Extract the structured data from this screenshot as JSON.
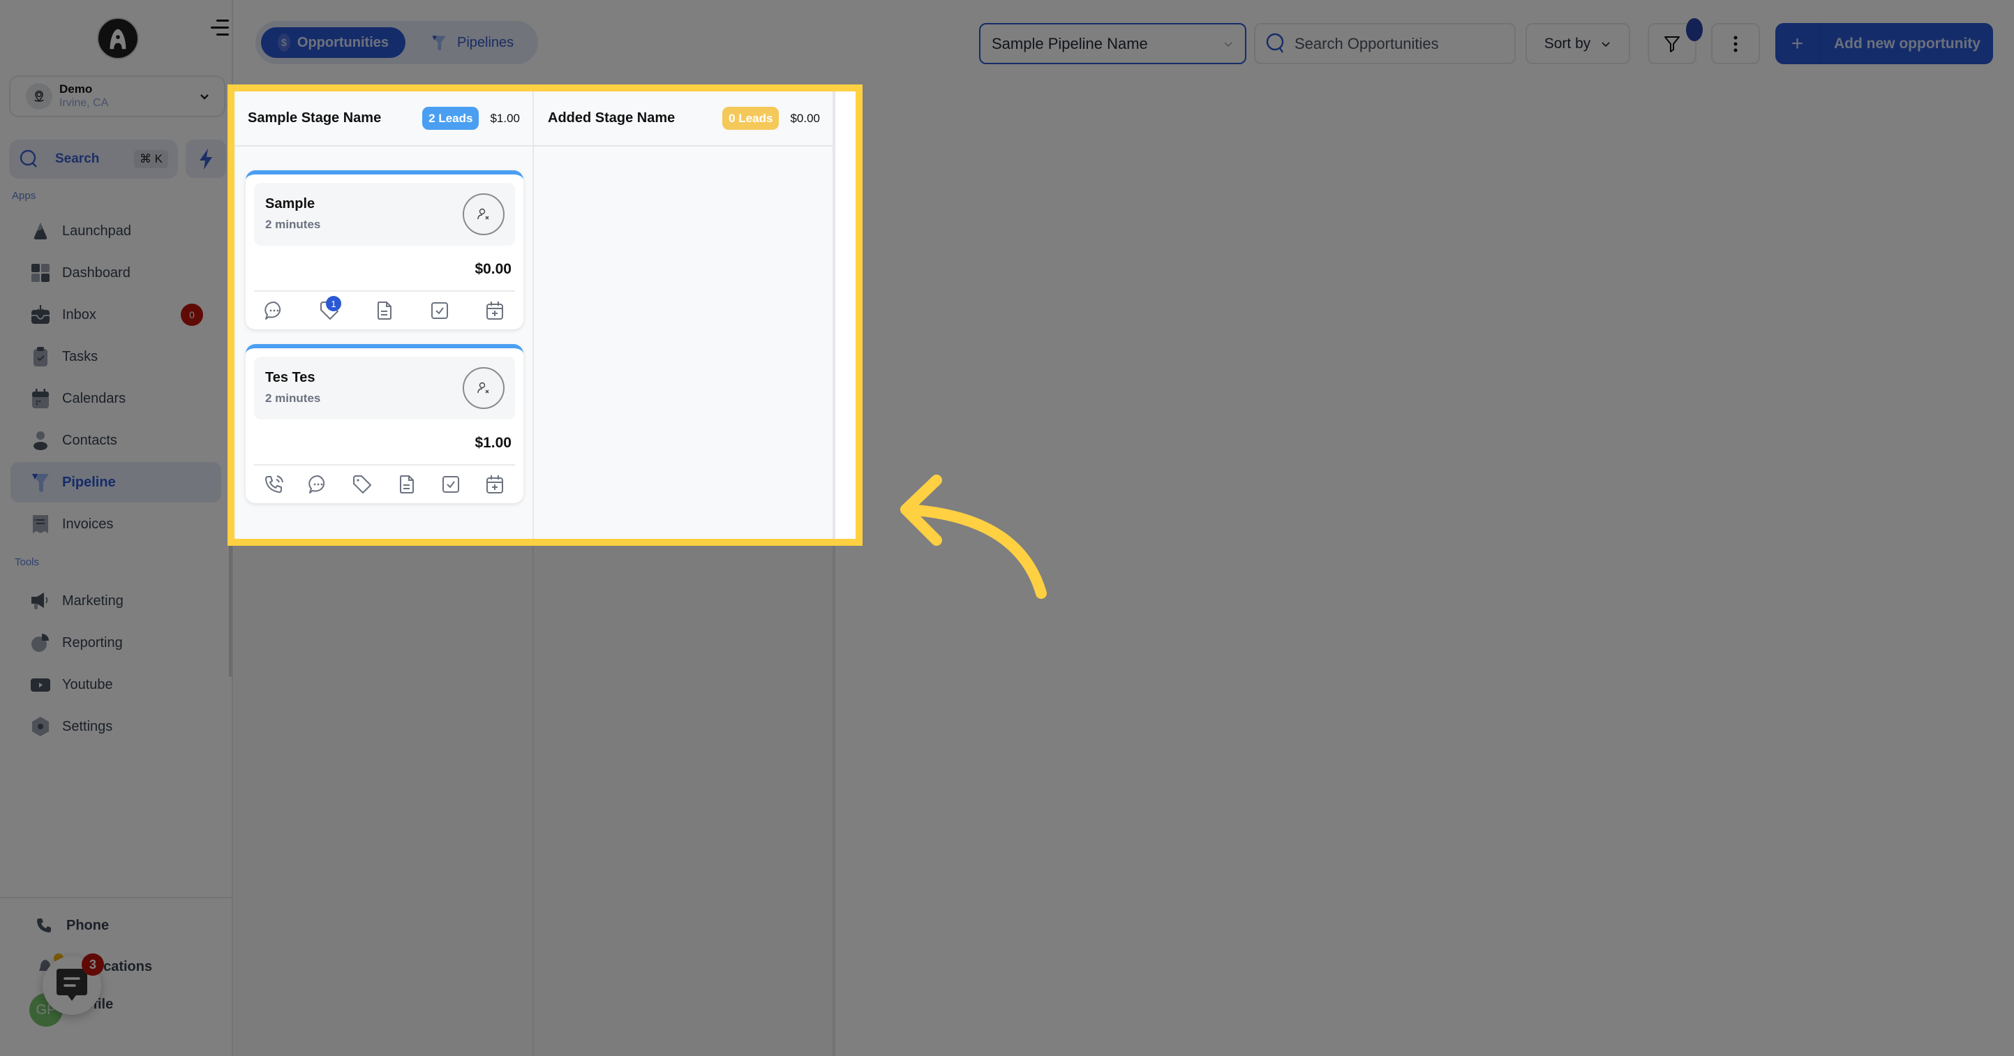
{
  "sidebar": {
    "location": {
      "name": "Demo",
      "subtitle": "Irvine, CA"
    },
    "search": {
      "label": "Search",
      "shortcut": "⌘ K"
    },
    "sections": {
      "apps": "Apps",
      "tools": "Tools"
    },
    "apps": [
      {
        "label": "Launchpad",
        "icon": "rocket-icon"
      },
      {
        "label": "Dashboard",
        "icon": "dashboard-icon"
      },
      {
        "label": "Inbox",
        "icon": "inbox-icon",
        "badge": "0"
      },
      {
        "label": "Tasks",
        "icon": "clipboard-check-icon"
      },
      {
        "label": "Calendars",
        "icon": "calendar-icon"
      },
      {
        "label": "Contacts",
        "icon": "person-icon"
      },
      {
        "label": "Pipeline",
        "icon": "funnel-icon",
        "active": true
      },
      {
        "label": "Invoices",
        "icon": "receipt-icon"
      }
    ],
    "tools": [
      {
        "label": "Marketing",
        "icon": "megaphone-icon"
      },
      {
        "label": "Reporting",
        "icon": "pie-chart-icon"
      },
      {
        "label": "Youtube",
        "icon": "play-icon"
      },
      {
        "label": "Settings",
        "icon": "gear-icon"
      }
    ],
    "bottom": {
      "phone": "Phone",
      "notifications": "Notifications",
      "profile": "Profile",
      "avatar_initials": "GP",
      "chat_badge": "3"
    }
  },
  "topbar": {
    "tabs": [
      {
        "label": "Opportunities",
        "active": true
      },
      {
        "label": "Pipelines",
        "active": false
      }
    ],
    "pipeline_select": "Sample Pipeline Name",
    "search_placeholder": "Search Opportunities",
    "sort_label": "Sort by",
    "add_label": "Add new opportunity"
  },
  "board": {
    "stages": [
      {
        "title": "Sample Stage Name",
        "leads": "2 Leads",
        "total": "$1.00",
        "badge_color": "#4a9ff2",
        "cards": [
          {
            "name": "Sample",
            "time": "2 minutes",
            "value": "$0.00",
            "actions": [
              "chat-icon",
              "tag-icon",
              "note-icon",
              "task-icon",
              "calendar-add-icon"
            ],
            "tag_count": "1"
          },
          {
            "name": "Tes Tes",
            "time": "2 minutes",
            "value": "$1.00",
            "actions": [
              "phone-call-icon",
              "chat-icon",
              "tag-icon",
              "note-icon",
              "task-icon",
              "calendar-add-icon"
            ]
          }
        ]
      },
      {
        "title": "Added Stage Name",
        "leads": "0 Leads",
        "total": "$0.00",
        "badge_color": "#f5c85a",
        "cards": []
      }
    ]
  },
  "colors": {
    "accent": "#2b59d4",
    "highlight": "#ffd042",
    "card_top": "#4a9ff2",
    "badge_red": "#c0140c"
  }
}
